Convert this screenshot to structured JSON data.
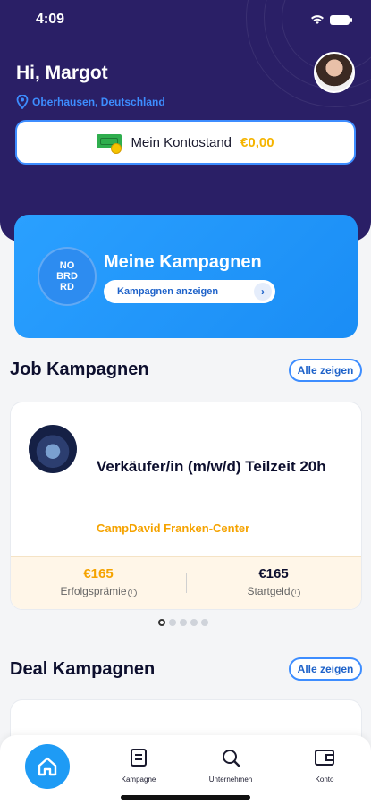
{
  "status_bar": {
    "time": "4:09"
  },
  "header": {
    "greeting": "Hi, Margot",
    "location": "Oberhausen, Deutschland"
  },
  "balance": {
    "label": "Mein Kontostand",
    "amount": "€0,00"
  },
  "kampagnen_banner": {
    "logo_text": "NO BRD RD",
    "title": "Meine Kampagnen",
    "button_label": "Kampagnen anzeigen"
  },
  "job_section": {
    "title": "Job Kampagnen",
    "see_all": "Alle zeigen",
    "card": {
      "title": "Verkäufer/in (m/w/d) Teilzeit 20h",
      "company": "CampDavid Franken-Center",
      "bonus_amount": "€165",
      "bonus_label": "Erfolgsprämie",
      "start_amount": "€165",
      "start_label": "Startgeld"
    },
    "pager": {
      "count": 5,
      "active": 1
    }
  },
  "deal_section": {
    "title": "Deal Kampagnen",
    "see_all": "Alle zeigen"
  },
  "tabbar": {
    "items": [
      {
        "label": "",
        "icon": "home-icon"
      },
      {
        "label": "Kampagne",
        "icon": "document-icon"
      },
      {
        "label": "Unternehmen",
        "icon": "search-icon"
      },
      {
        "label": "Konto",
        "icon": "wallet-icon"
      }
    ]
  },
  "colors": {
    "hero": "#2a1f66",
    "accent": "#3d8dff",
    "amount": "#f5b400",
    "company": "#f5a300"
  }
}
